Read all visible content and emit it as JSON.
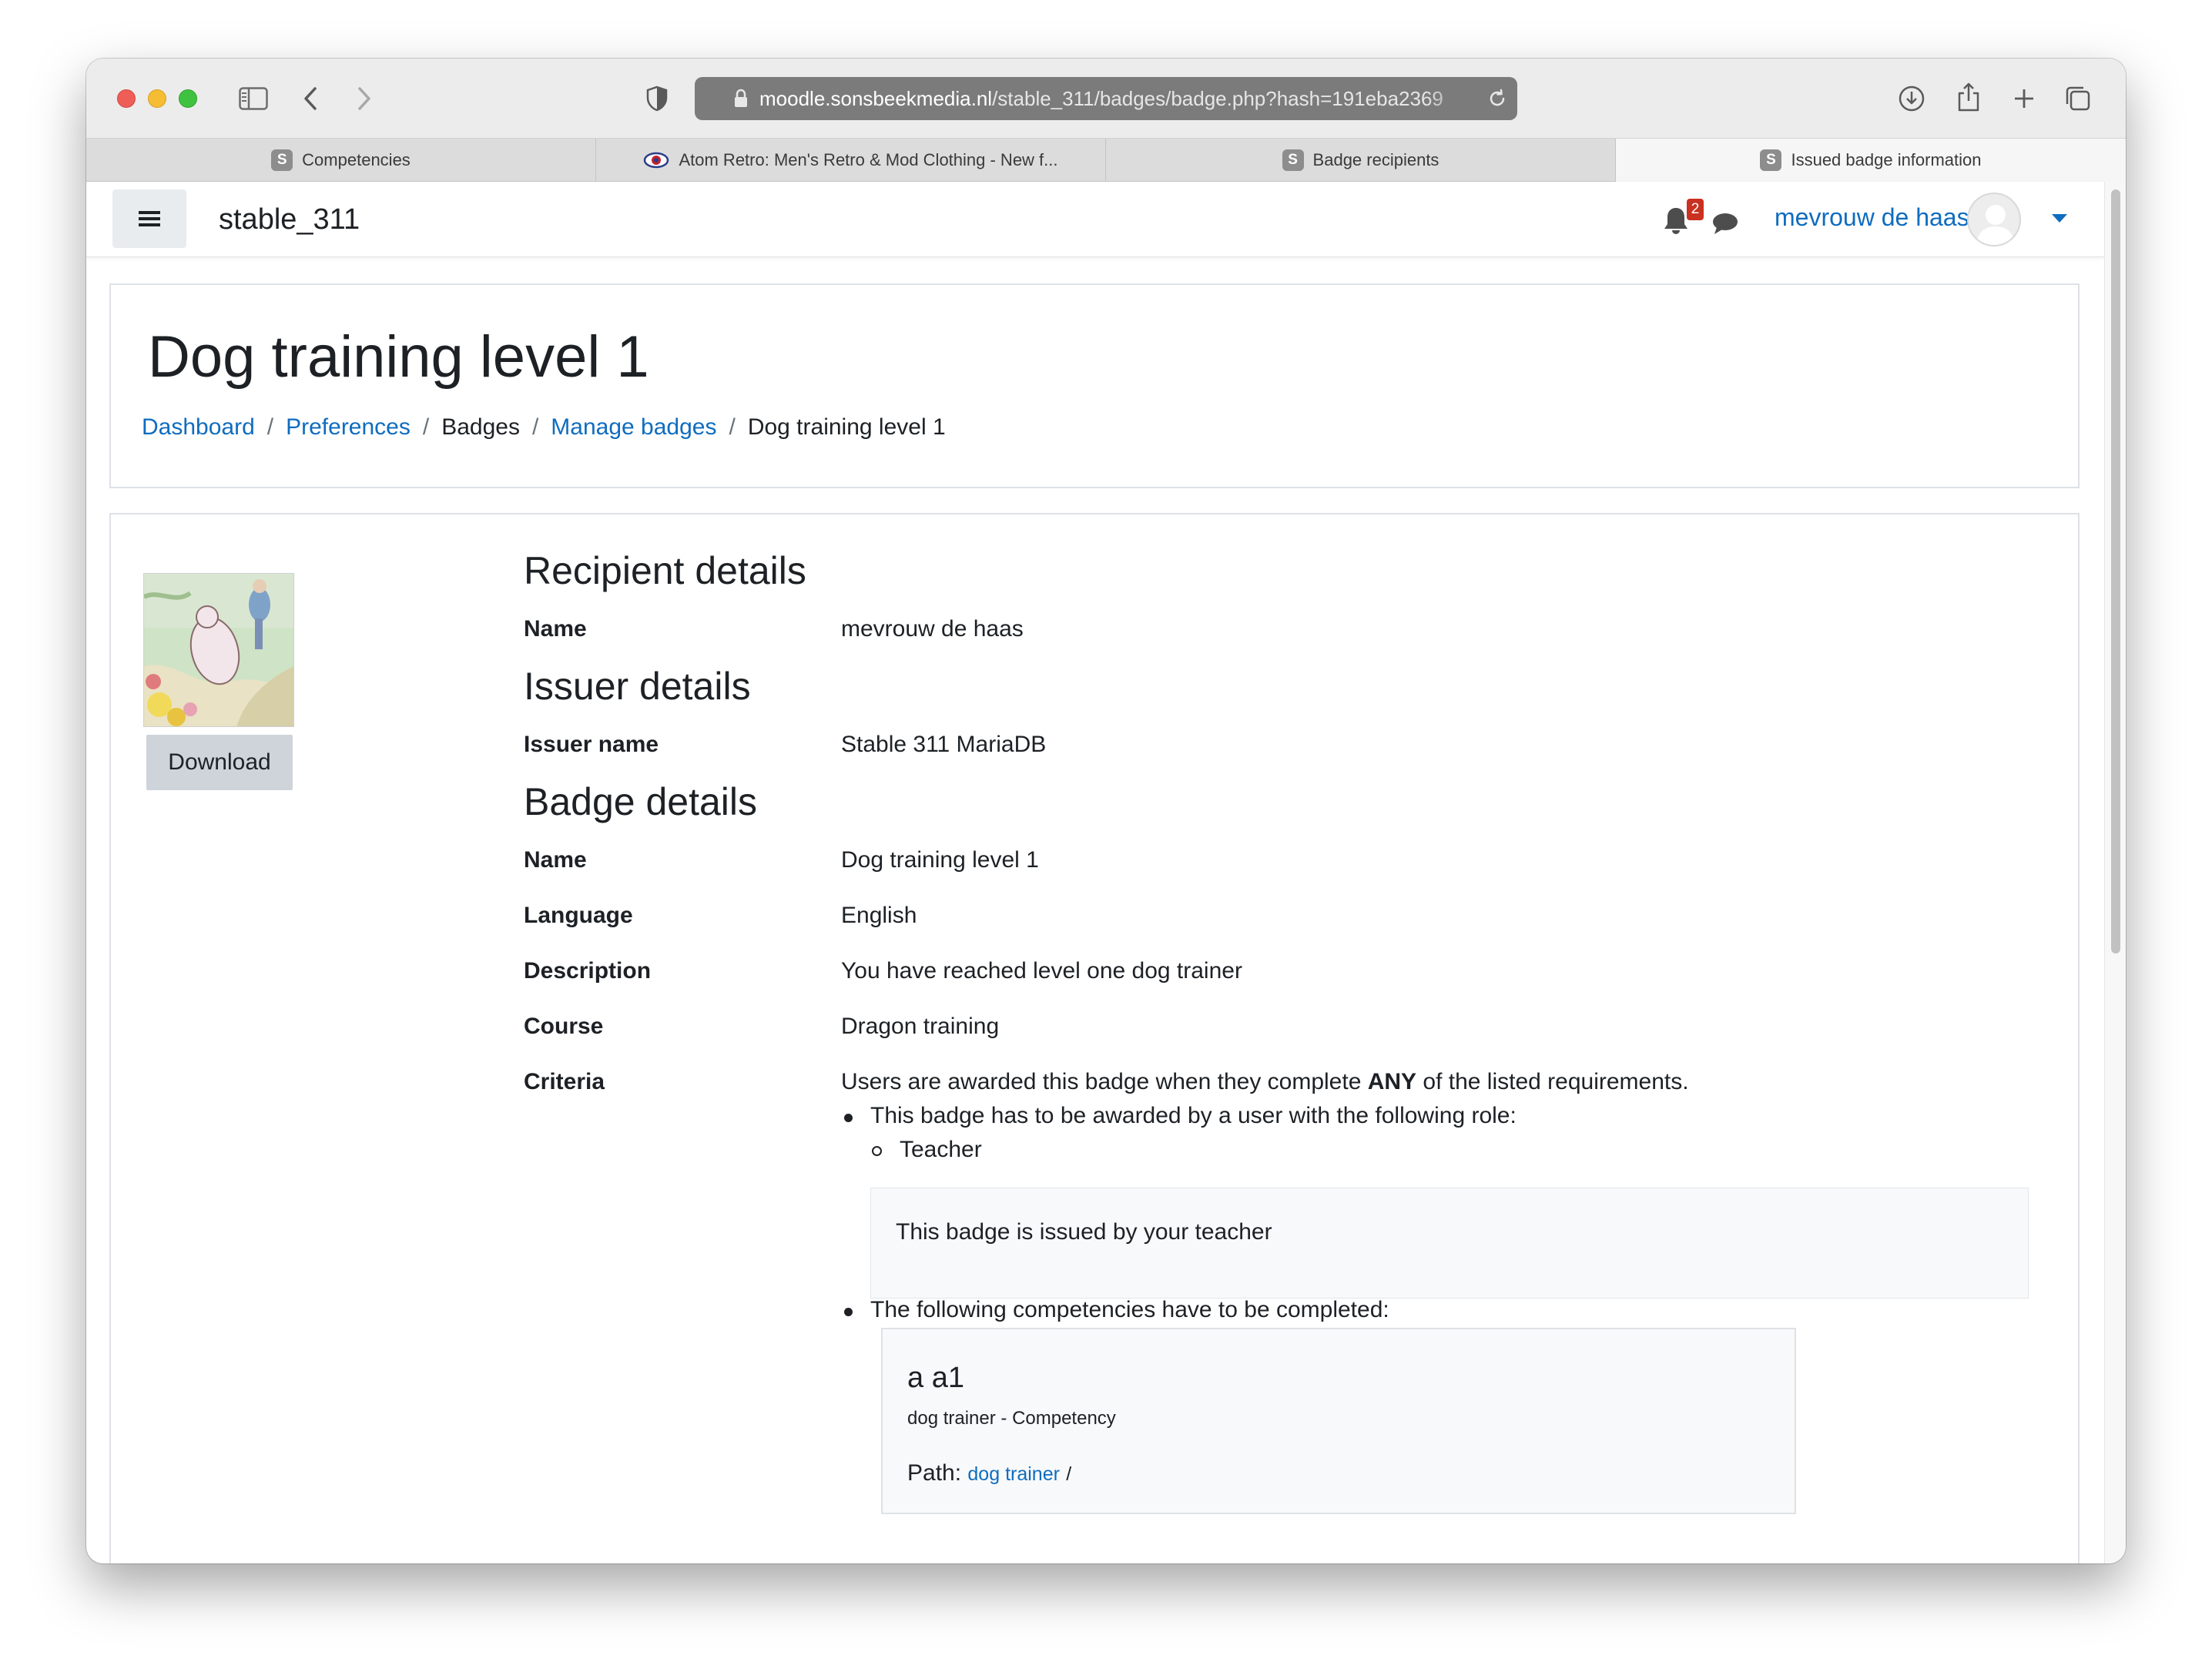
{
  "browser": {
    "url_host": "moodle.sonsbeekmedia.nl",
    "url_path": "/stable_311/badges/badge.php?hash=191eba2369",
    "tabs": [
      {
        "label": "Competencies",
        "favicon": "S",
        "active": false
      },
      {
        "label": "Atom Retro: Men's Retro & Mod Clothing - New f...",
        "favicon": "eye-icon",
        "active": false
      },
      {
        "label": "Badge recipients",
        "favicon": "S",
        "active": false
      },
      {
        "label": "Issued badge information",
        "favicon": "S",
        "active": true
      }
    ]
  },
  "navbar": {
    "site_name": "stable_311",
    "notification_count": "2",
    "user_name": "mevrouw de haas"
  },
  "header": {
    "title": "Dog training level 1",
    "breadcrumb": [
      {
        "label": "Dashboard",
        "link": true
      },
      {
        "label": "Preferences",
        "link": true
      },
      {
        "label": "Badges",
        "link": false
      },
      {
        "label": "Manage badges",
        "link": true
      },
      {
        "label": "Dog training level 1",
        "link": false
      }
    ]
  },
  "badge": {
    "download_label": "Download",
    "recipient_title": "Recipient details",
    "recipient_name_label": "Name",
    "recipient_name": "mevrouw de haas",
    "issuer_title": "Issuer details",
    "issuer_name_label": "Issuer name",
    "issuer_name": "Stable 311 MariaDB",
    "details_title": "Badge details",
    "name_label": "Name",
    "name": "Dog training level 1",
    "language_label": "Language",
    "language": "English",
    "description_label": "Description",
    "description": "You have reached level one dog trainer",
    "course_label": "Course",
    "course": "Dragon training",
    "criteria_label": "Criteria",
    "criteria_intro_pre": "Users are awarded this badge when they complete ",
    "criteria_intro_bold": "ANY",
    "criteria_intro_post": " of the listed requirements.",
    "criteria_role_text": "This badge has to be awarded by a user with the following role:",
    "criteria_role": "Teacher",
    "criteria_role_note": "This badge is issued by your teacher",
    "criteria_competency_text": "The following competencies have to be completed:",
    "competency_title": "a a1",
    "competency_subtitle": "dog trainer - Competency",
    "competency_path_label": "Path:",
    "competency_path_link": "dog trainer",
    "competency_path_sep": "/"
  },
  "colors": {
    "link": "#0f6cbf",
    "text": "#1d2125",
    "button_bg": "#ced4da",
    "badge_notification": "#ca3120"
  }
}
